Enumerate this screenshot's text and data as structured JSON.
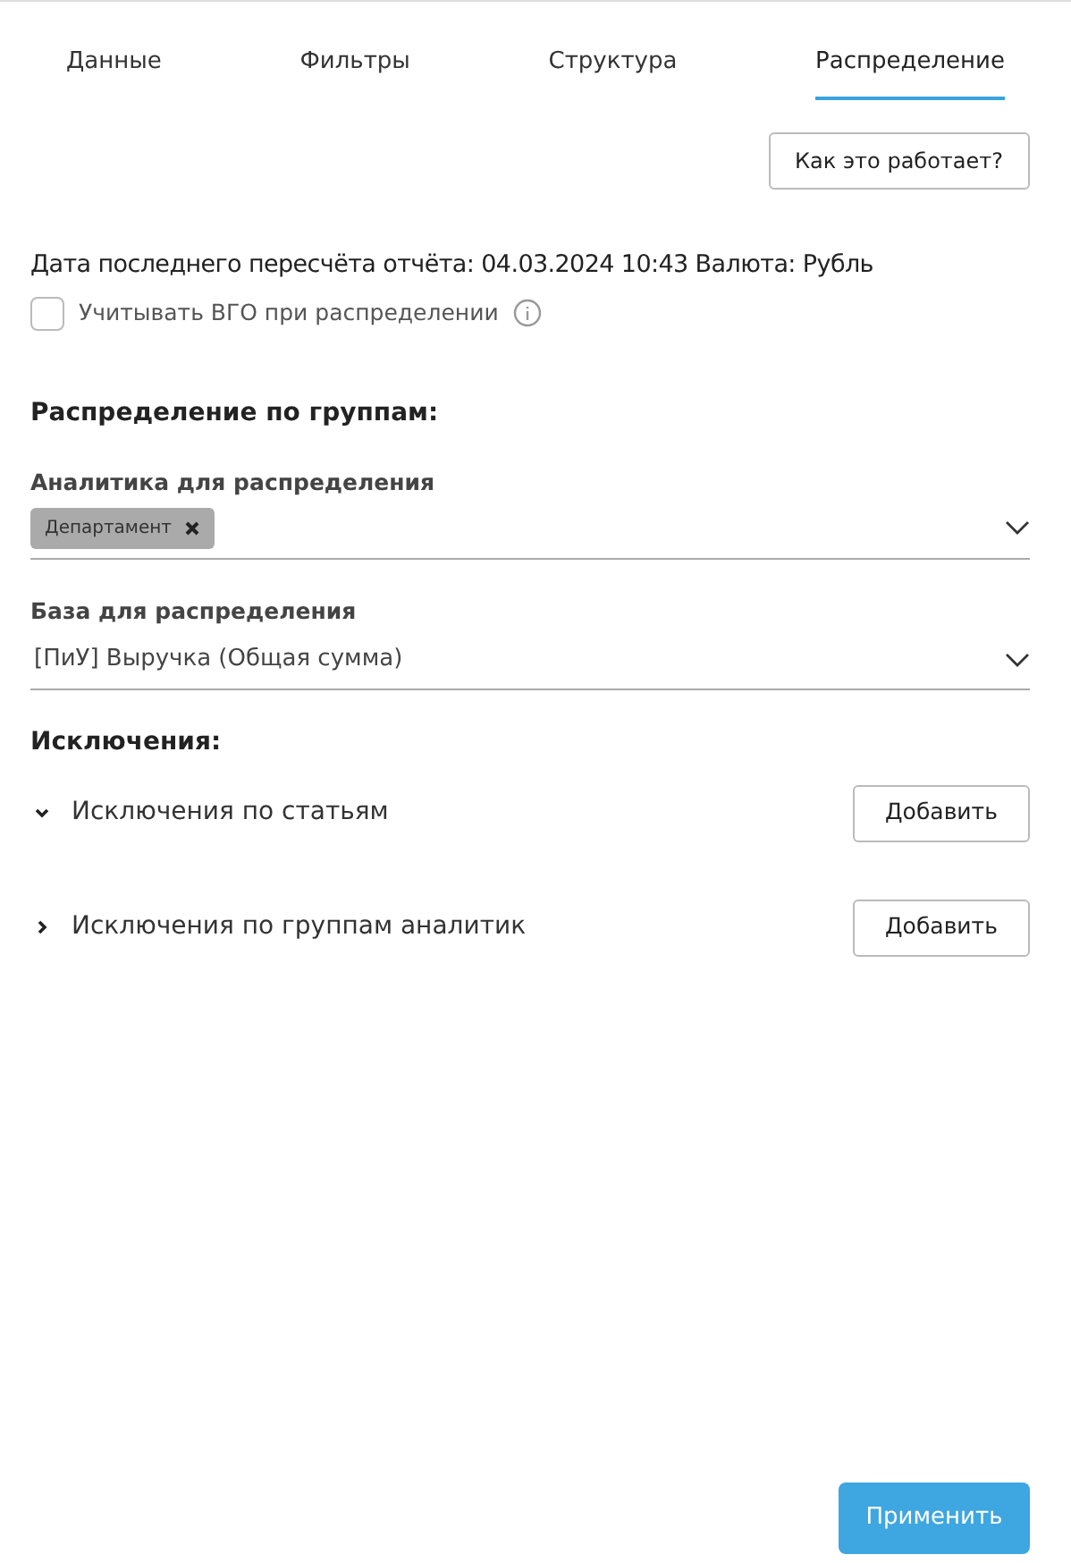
{
  "tabs": [
    {
      "label": "Данные",
      "selected": false
    },
    {
      "label": "Фильтры",
      "selected": false
    },
    {
      "label": "Структура",
      "selected": false
    },
    {
      "label": "Распределение",
      "selected": true
    }
  ],
  "help_button": "Как это работает?",
  "recalc_info": "Дата последнего пересчёта отчёта: 04.03.2024 10:43 Валюта: Рубль",
  "intercompany_checkbox": {
    "label": "Учитывать ВГО при распределении",
    "checked": false
  },
  "groups_heading": "Распределение по группам:",
  "analytics_select": {
    "label": "Аналитика для распределения",
    "tags": [
      "Департамент"
    ]
  },
  "base_select": {
    "label": "База для распределения",
    "value": "[ПиУ] Выручка (Общая сумма)"
  },
  "exclusions_heading": "Исключения:",
  "exclusions": [
    {
      "label": "Исключения по статьям",
      "expanded": true,
      "button": "Добавить"
    },
    {
      "label": "Исключения по группам аналитик",
      "expanded": false,
      "button": "Добавить"
    }
  ],
  "apply_button": "Применить"
}
